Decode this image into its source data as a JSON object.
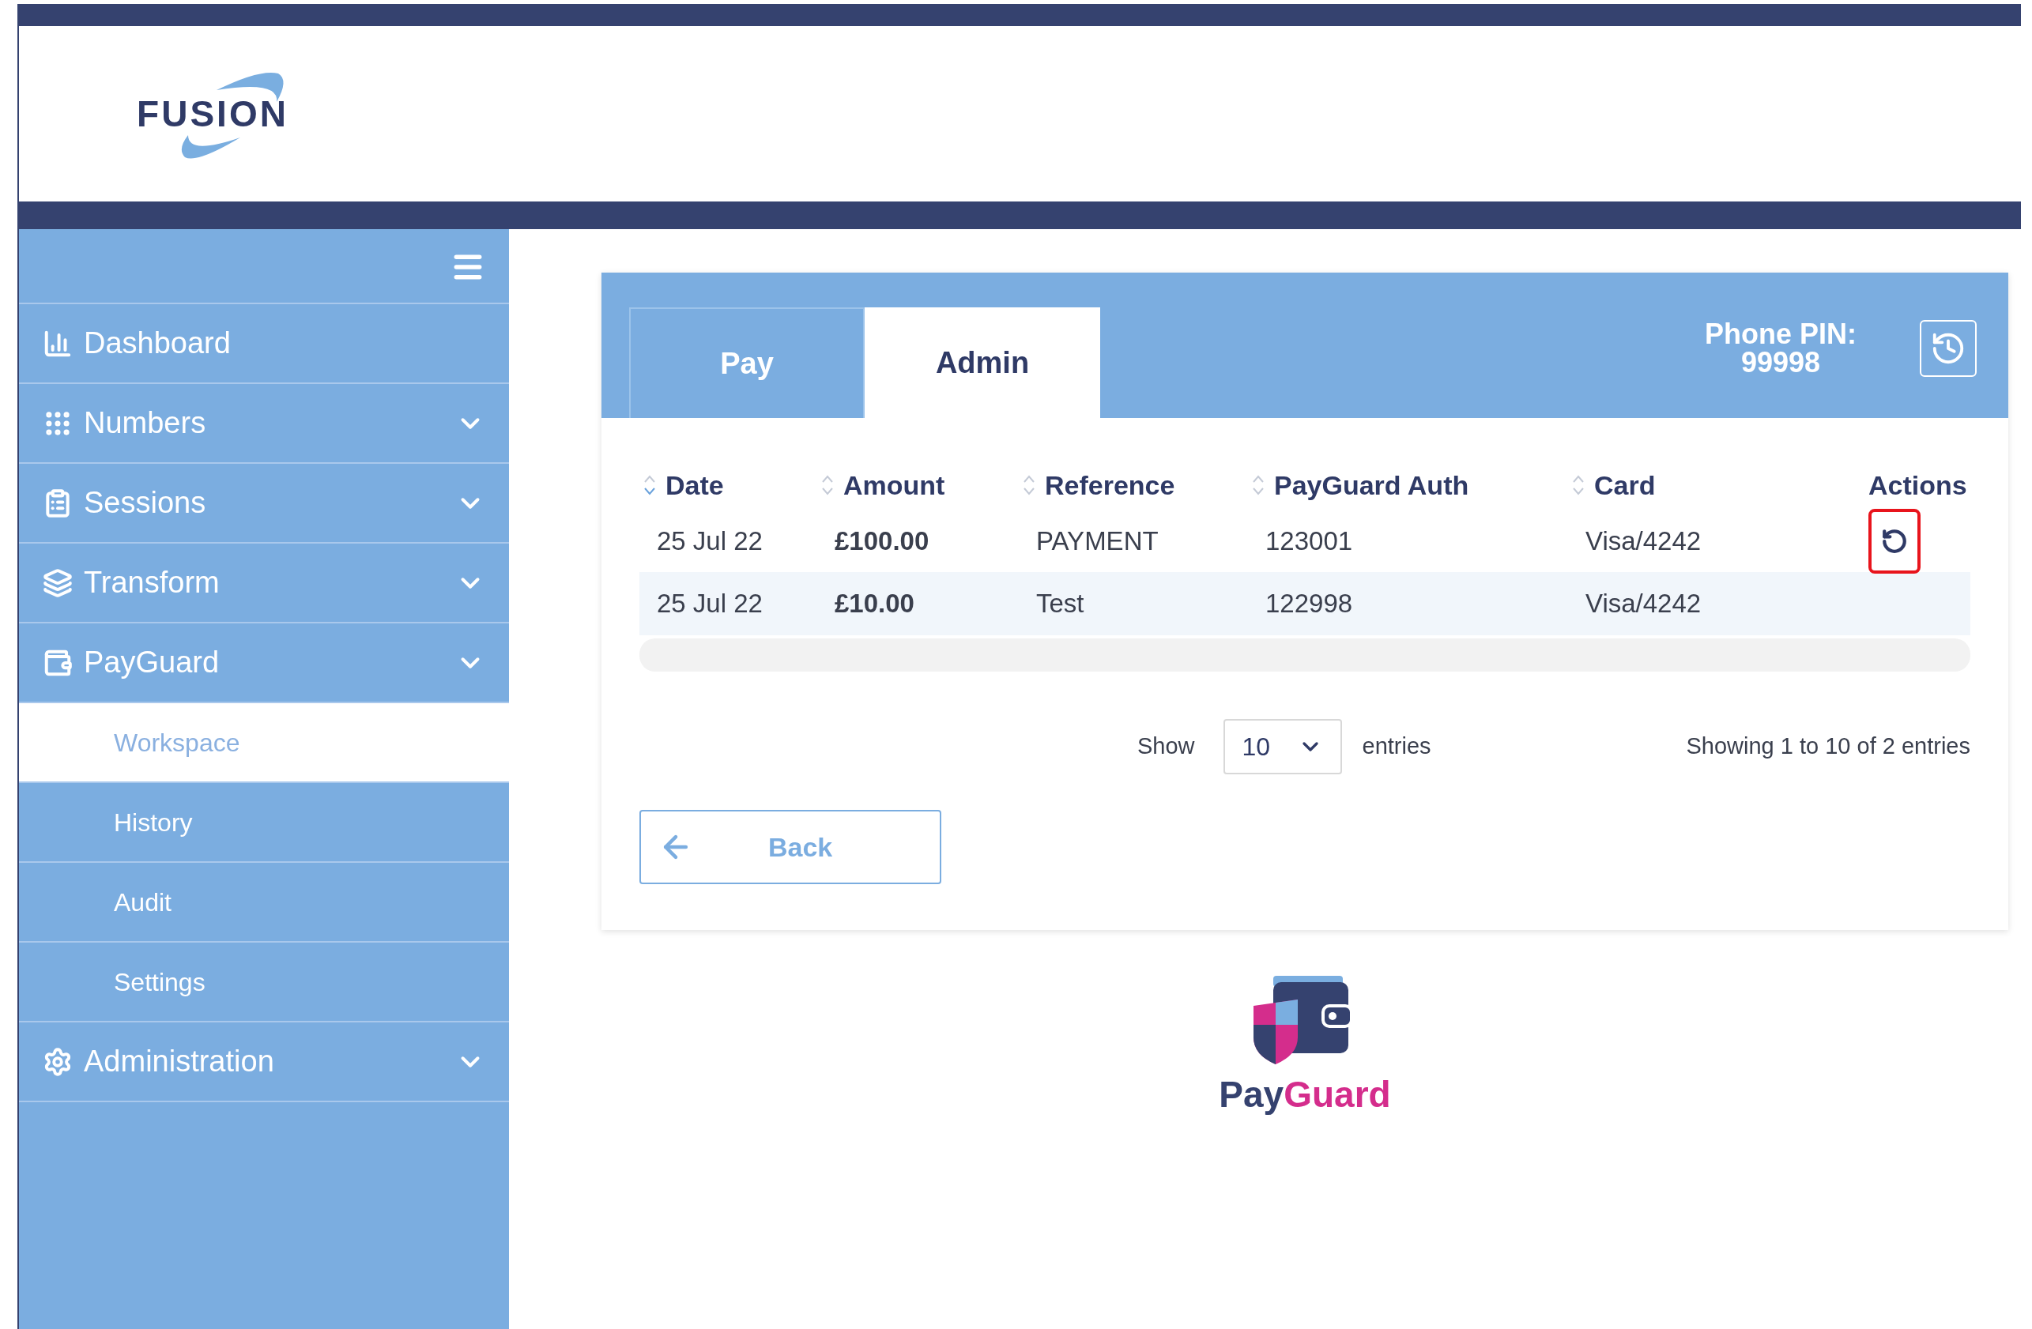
{
  "brand": {
    "text": "FUSION"
  },
  "sidebar": {
    "items": [
      {
        "label": "Dashboard",
        "kind": "link"
      },
      {
        "label": "Numbers",
        "kind": "menu"
      },
      {
        "label": "Sessions",
        "kind": "menu"
      },
      {
        "label": "Transform",
        "kind": "menu"
      },
      {
        "label": "PayGuard",
        "kind": "menu",
        "children": [
          {
            "label": "Workspace",
            "selected": true
          },
          {
            "label": "History",
            "selected": false
          },
          {
            "label": "Audit",
            "selected": false
          },
          {
            "label": "Settings",
            "selected": false
          }
        ]
      },
      {
        "label": "Administration",
        "kind": "menu"
      }
    ]
  },
  "tabs": [
    {
      "label": "Pay",
      "selected": false
    },
    {
      "label": "Admin",
      "selected": true
    }
  ],
  "phone_pin": {
    "label": "Phone PIN:",
    "value": "99998"
  },
  "table": {
    "columns": [
      {
        "label": "Date",
        "sortable": true,
        "sorted": true
      },
      {
        "label": "Amount",
        "sortable": true,
        "sorted": false
      },
      {
        "label": "Reference",
        "sortable": true,
        "sorted": false
      },
      {
        "label": "PayGuard Auth",
        "sortable": true,
        "sorted": false
      },
      {
        "label": "Card",
        "sortable": true,
        "sorted": false
      },
      {
        "label": "Actions",
        "sortable": false
      }
    ],
    "rows": [
      {
        "date": "25 Jul 22",
        "amount": "£100.00",
        "reference": "PAYMENT",
        "auth": "123001",
        "card": "Visa/4242",
        "action": {
          "kind": "undo",
          "highlighted": true
        }
      },
      {
        "date": "25 Jul 22",
        "amount": "£10.00",
        "reference": "Test",
        "auth": "122998",
        "card": "Visa/4242"
      }
    ]
  },
  "pagination": {
    "show_label": "Show",
    "page_size": "10",
    "entries_label": "entries",
    "summary": "Showing 1 to 10 of 2 entries"
  },
  "back_button": {
    "label": "Back"
  },
  "footer_logo": {
    "text_1": "Pay",
    "text_2": "Guard"
  }
}
